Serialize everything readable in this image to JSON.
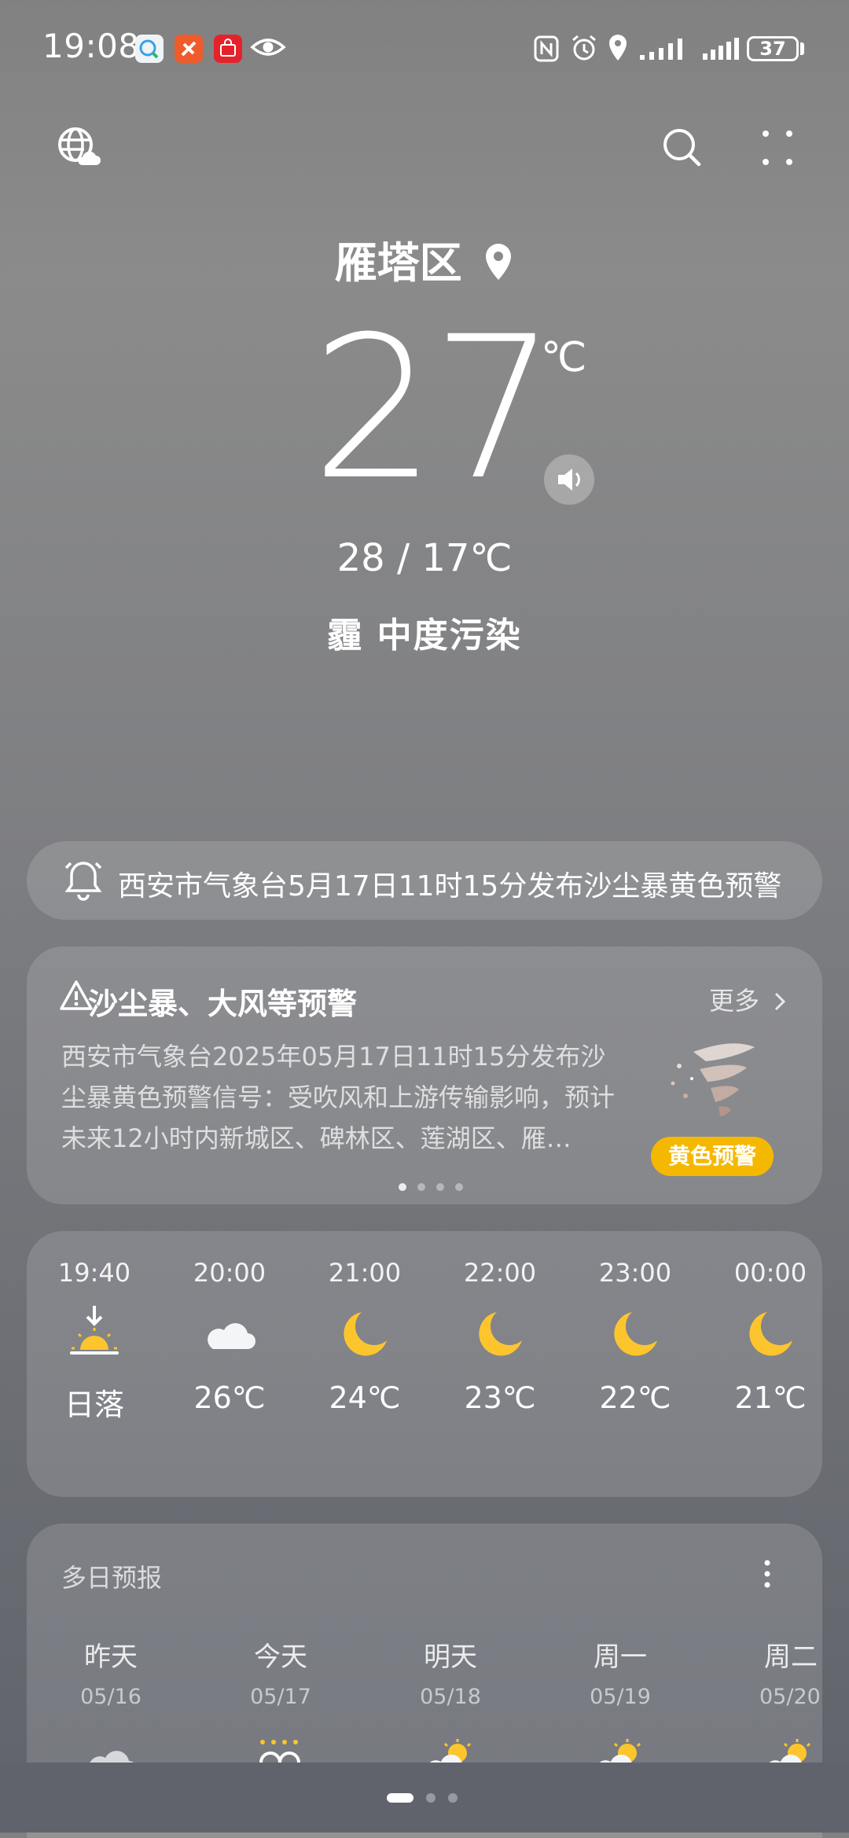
{
  "status_bar": {
    "time": "19:08",
    "battery": "37"
  },
  "header": {
    "location": "雁塔区",
    "temperature": "27",
    "unit": "℃",
    "high_low": "28 / 17℃",
    "condition": "霾  中度污染"
  },
  "ticker": {
    "text": "西安市气象台5月17日11时15分发布沙尘暴黄色预警"
  },
  "alert": {
    "title": "沙尘暴、大风等预警",
    "more": "更多",
    "body": "西安市气象台2025年05月17日11时15分发布沙尘暴黄色预警信号：受吹风和上游传输影响，预计未来12小时内新城区、碑林区、莲湖区、雁…",
    "badge": "黄色预警",
    "badge_color": "#f5b800"
  },
  "hourly": [
    {
      "time": "19:40",
      "icon": "sunset-icon",
      "value": "日落"
    },
    {
      "time": "20:00",
      "icon": "cloud-icon",
      "value": "26℃"
    },
    {
      "time": "21:00",
      "icon": "moon-icon",
      "value": "24℃"
    },
    {
      "time": "22:00",
      "icon": "moon-icon",
      "value": "23℃"
    },
    {
      "time": "23:00",
      "icon": "moon-icon",
      "value": "22℃"
    },
    {
      "time": "00:00",
      "icon": "moon-icon",
      "value": "21℃"
    }
  ],
  "daily": {
    "title": "多日预报",
    "days": [
      {
        "name": "昨天",
        "date": "05/16",
        "icon": "cloud-icon"
      },
      {
        "name": "今天",
        "date": "05/17",
        "icon": "haze-icon"
      },
      {
        "name": "明天",
        "date": "05/18",
        "icon": "partly-cloudy-icon"
      },
      {
        "name": "周一",
        "date": "05/19",
        "icon": "partly-cloudy-icon"
      },
      {
        "name": "周二",
        "date": "05/20",
        "icon": "partly-cloudy-icon"
      }
    ]
  }
}
